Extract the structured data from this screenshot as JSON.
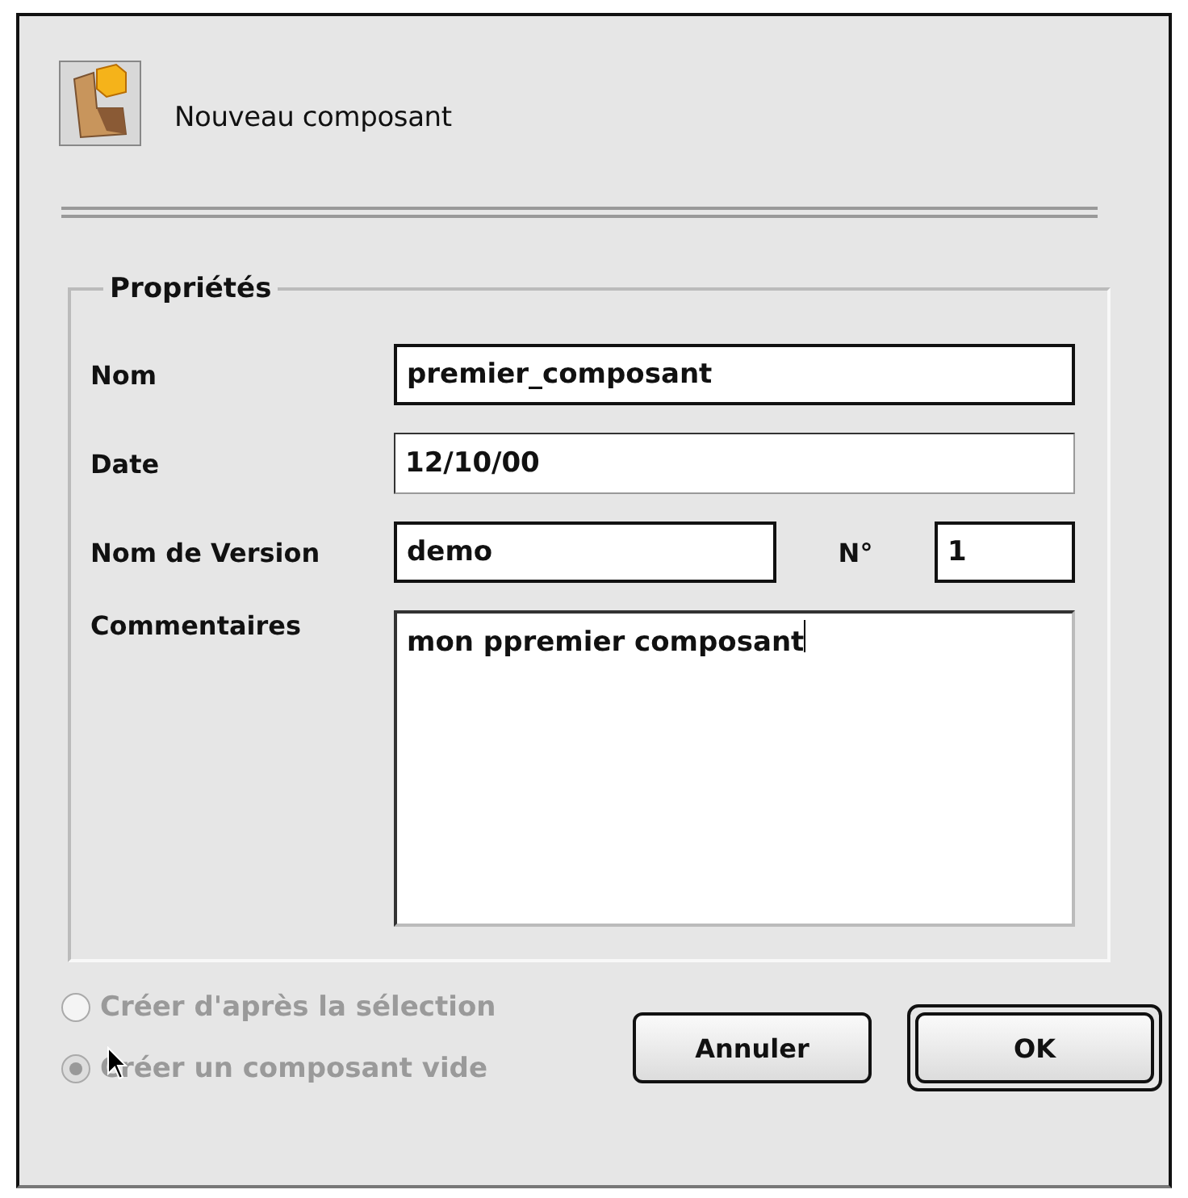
{
  "dialog": {
    "title": "Nouveau composant"
  },
  "properties": {
    "legend": "Propriétés",
    "name": {
      "label": "Nom",
      "value": "premier_composant"
    },
    "date": {
      "label": "Date",
      "value": "12/10/00"
    },
    "version": {
      "label": "Nom de Version",
      "value": "demo",
      "number_label": "N°",
      "number": "1"
    },
    "comments": {
      "label": "Commentaires",
      "value": "mon ppremier composant"
    }
  },
  "options": [
    {
      "label": "Créer d'après la sélection",
      "selected": false,
      "disabled": true
    },
    {
      "label": "Créer un composant vide",
      "selected": true,
      "disabled": true
    }
  ],
  "buttons": [
    {
      "label": "Annuler",
      "default": false
    },
    {
      "label": "OK",
      "default": true
    }
  ]
}
